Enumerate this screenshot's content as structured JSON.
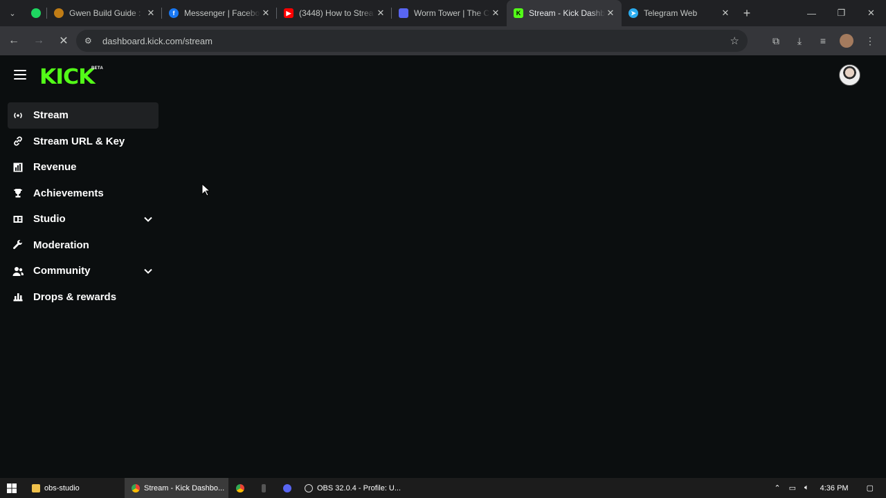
{
  "browser": {
    "tabs": [
      {
        "title": "",
        "icon": "spotify-icon",
        "color": "#1ed760"
      },
      {
        "title": "Gwen Build Guide :",
        "icon": "mobafire-icon",
        "color": "#c07c15"
      },
      {
        "title": "Messenger | Facebo",
        "icon": "facebook-icon",
        "color": "#1877f2"
      },
      {
        "title": "(3448) How to Strea",
        "icon": "youtube-icon",
        "color": "#ff0000"
      },
      {
        "title": "Worm Tower | The C",
        "icon": "discord-icon",
        "color": "#5865f2"
      },
      {
        "title": "Stream - Kick Dashb",
        "icon": "kick-icon",
        "color": "#53fc18",
        "active": true
      },
      {
        "title": "Telegram Web",
        "icon": "telegram-icon",
        "color": "#2aabee"
      }
    ],
    "url": "dashboard.kick.com/stream"
  },
  "page": {
    "logo_text": "KICK",
    "logo_badge": "BETA",
    "accent": "#53fc18",
    "nav": [
      {
        "label": "Stream",
        "icon": "broadcast-icon",
        "active": true
      },
      {
        "label": "Stream URL & Key",
        "icon": "link-icon"
      },
      {
        "label": "Revenue",
        "icon": "chart-icon"
      },
      {
        "label": "Achievements",
        "icon": "trophy-icon"
      },
      {
        "label": "Studio",
        "icon": "studio-icon",
        "expandable": true
      },
      {
        "label": "Moderation",
        "icon": "wrench-icon"
      },
      {
        "label": "Community",
        "icon": "people-icon",
        "expandable": true
      },
      {
        "label": "Drops & rewards",
        "icon": "gift-icon"
      }
    ]
  },
  "taskbar": {
    "items": [
      {
        "label": "obs-studio",
        "icon": "folder-icon"
      },
      {
        "label": "Stream - Kick Dashbo...",
        "icon": "chrome-icon",
        "active": true
      },
      {
        "label": "",
        "icon": "chrome-icon"
      },
      {
        "label": "",
        "icon": "app-icon"
      },
      {
        "label": "",
        "icon": "discord-icon"
      },
      {
        "label": "OBS 32.0.4 - Profile: U...",
        "icon": "obs-icon"
      }
    ],
    "clock": "4:36 PM"
  }
}
